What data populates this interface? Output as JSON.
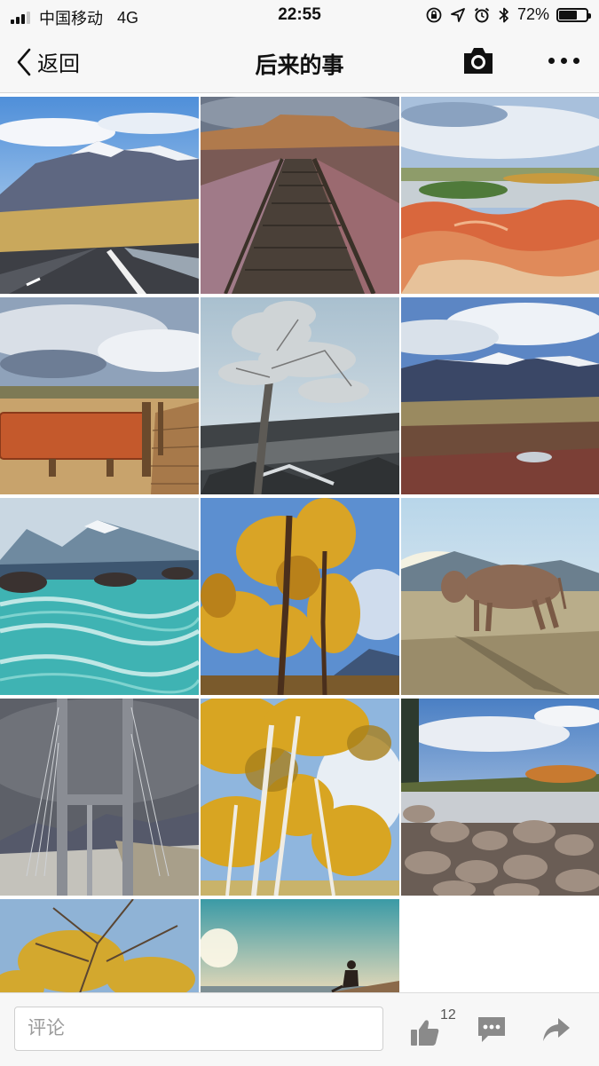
{
  "status_bar": {
    "carrier": "中国移动",
    "network": "4G",
    "time": "22:55",
    "battery_percent_label": "72%",
    "battery_level": 0.72,
    "signal_bars_active": 3,
    "signal_bars_total": 4
  },
  "nav": {
    "back_label": "返回",
    "title": "后来的事",
    "camera_icon": "camera-icon",
    "more_icon": "more-dots-icon"
  },
  "photos": [
    {
      "subject": "snowy mountains over highway"
    },
    {
      "subject": "wooden boardwalk through badlands"
    },
    {
      "subject": "red eroded hills by river"
    },
    {
      "subject": "wooden sign with boardwalk"
    },
    {
      "subject": "lone frosted tree"
    },
    {
      "subject": "snow-capped range and plains"
    },
    {
      "subject": "turquoise rushing river"
    },
    {
      "subject": "golden larch trees"
    },
    {
      "subject": "cow on grassland"
    },
    {
      "subject": "suspension bridge tower"
    },
    {
      "subject": "yellow birch forest"
    },
    {
      "subject": "river with round stones"
    },
    {
      "subject": "autumn branches"
    },
    {
      "subject": "person sitting at lakeside"
    }
  ],
  "bottom_bar": {
    "comment_placeholder": "评论",
    "like_count": "12",
    "like_icon": "thumbs-up-icon",
    "message_icon": "comment-bubble-icon",
    "share_icon": "share-arrow-icon"
  }
}
